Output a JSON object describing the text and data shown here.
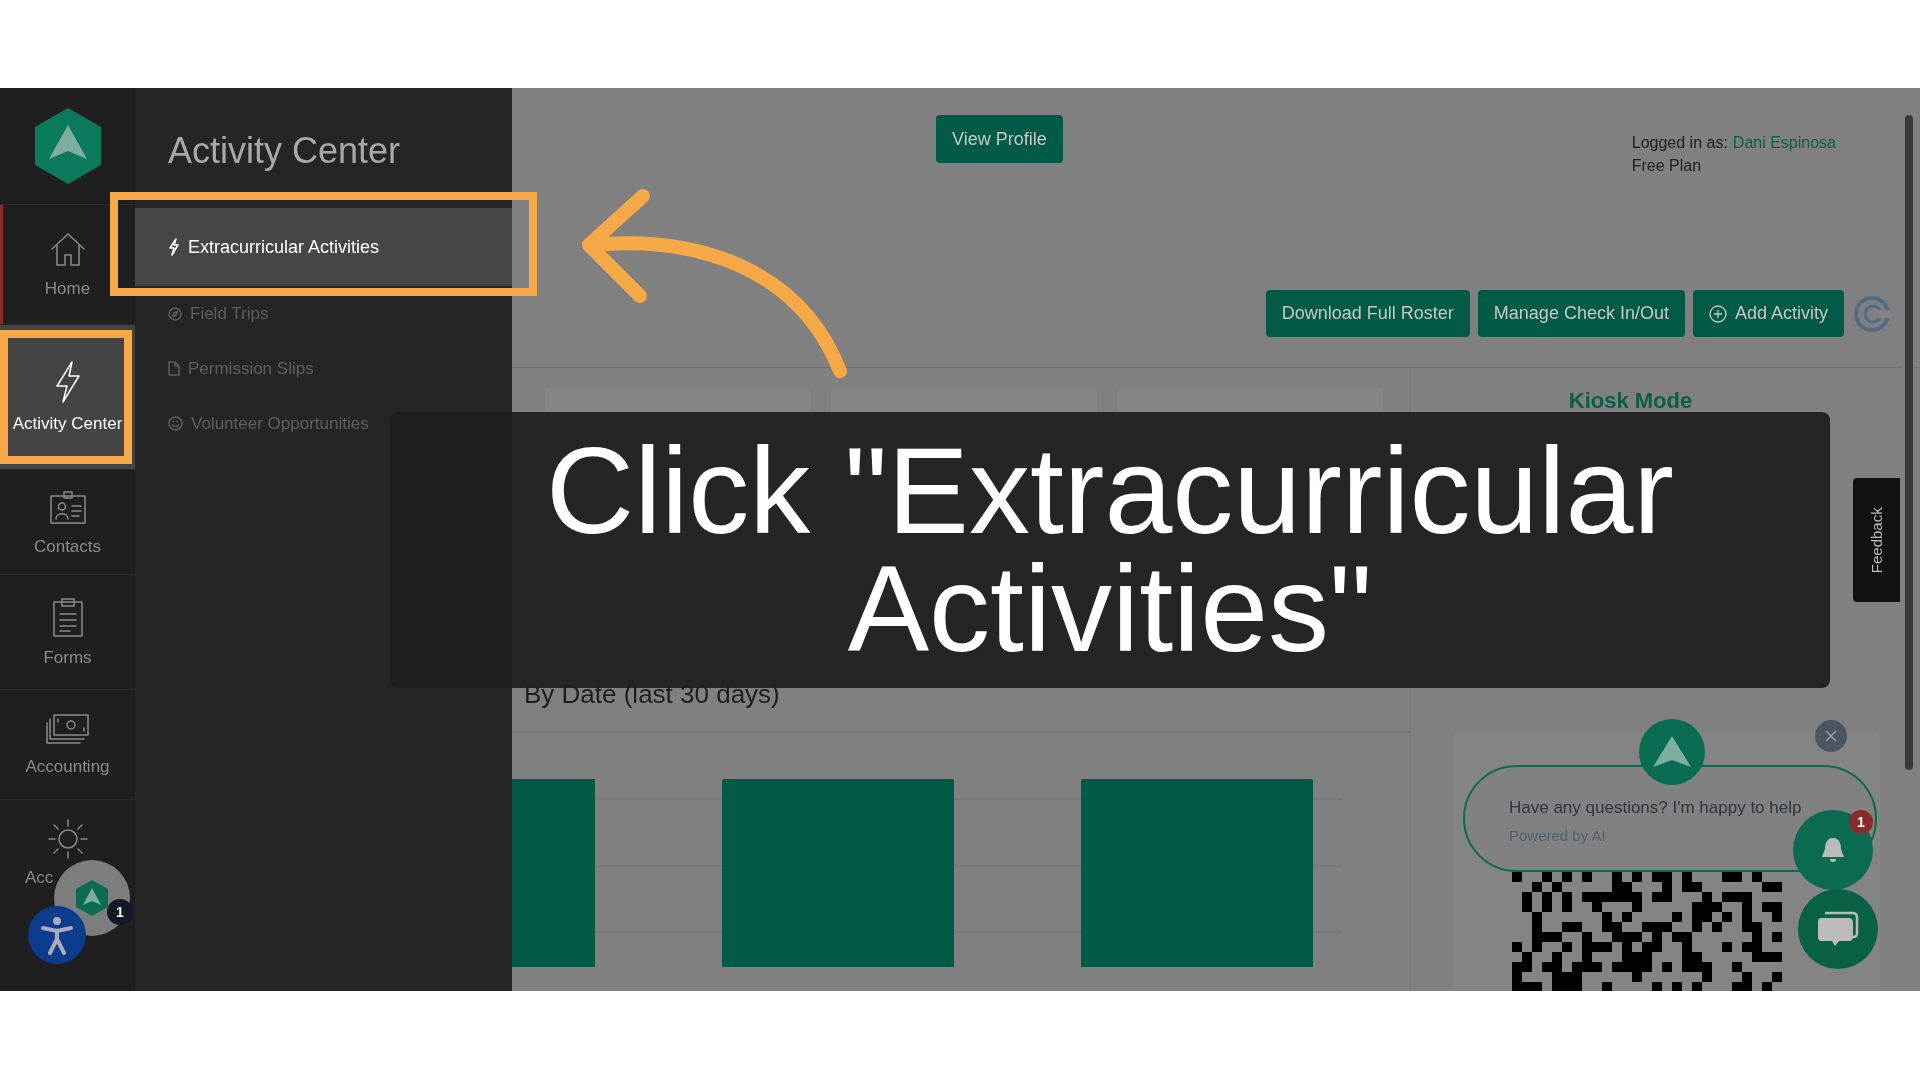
{
  "sidebar": {
    "items": [
      {
        "label": "Home",
        "selected": false,
        "current": true
      },
      {
        "label": "Activity Center",
        "selected": true,
        "current": false
      },
      {
        "label": "Contacts",
        "selected": false,
        "current": false
      },
      {
        "label": "Forms",
        "selected": false,
        "current": false
      },
      {
        "label": "Accounting",
        "selected": false,
        "current": false
      },
      {
        "label": "Acc",
        "selected": false,
        "current": false
      }
    ],
    "avatar_badge": "1"
  },
  "flyout": {
    "title": "Activity Center",
    "items": [
      {
        "label": "Extracurricular Activities",
        "selected": true
      },
      {
        "label": "Field Trips",
        "selected": false
      },
      {
        "label": "Permission Slips",
        "selected": false
      },
      {
        "label": "Volunteer Opportunities",
        "selected": false
      }
    ]
  },
  "header": {
    "view_profile": "View Profile",
    "logged_in_label": "Logged in as:",
    "user": "Dani Espinosa",
    "plan": "Free Plan"
  },
  "actions": [
    {
      "label": "Download Full Roster",
      "kind": "plain"
    },
    {
      "label": "Manage Check In/Out",
      "kind": "plain"
    },
    {
      "label": "Add Activity",
      "kind": "add"
    }
  ],
  "chart_title": "By Date (last 30 days)",
  "kiosk": {
    "title": "Kiosk Mode"
  },
  "feedback": "Feedback",
  "chat": {
    "message": "Have any questions? I'm happy to help",
    "powered": "Powered by AI",
    "badge": "1"
  },
  "caption": "Click \"Extracurricular Activities\""
}
